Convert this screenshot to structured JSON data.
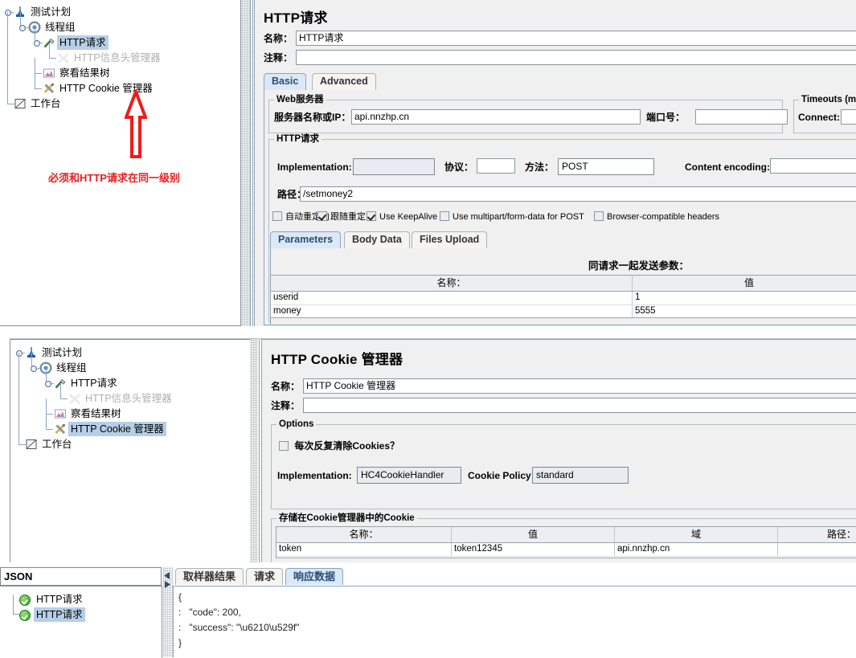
{
  "annotation": {
    "text": "必须和HTTP请求在同一级别",
    "color": "#ee1c1c",
    "arrow": "up-arrow-icon"
  },
  "tree_top": {
    "nodes": [
      {
        "label": "测试计划",
        "icon": "test-plan-icon",
        "state": "normal",
        "indent": 0
      },
      {
        "label": "线程组",
        "icon": "thread-group-icon",
        "state": "normal",
        "indent": 1
      },
      {
        "label": "HTTP请求",
        "icon": "http-request-icon",
        "state": "selected",
        "indent": 2
      },
      {
        "label": "HTTP信息头管理器",
        "icon": "header-manager-icon",
        "state": "disabled",
        "indent": 3
      },
      {
        "label": "察看结果树",
        "icon": "view-results-tree-icon",
        "state": "normal",
        "indent": 2
      },
      {
        "label": "HTTP Cookie 管理器",
        "icon": "cookie-manager-icon",
        "state": "normal",
        "indent": 2
      },
      {
        "label": "工作台",
        "icon": "workbench-icon",
        "state": "normal",
        "indent": 0
      }
    ]
  },
  "tree_bottom": {
    "nodes": [
      {
        "label": "测试计划",
        "icon": "test-plan-icon",
        "state": "normal",
        "indent": 0
      },
      {
        "label": "线程组",
        "icon": "thread-group-icon",
        "state": "normal",
        "indent": 1
      },
      {
        "label": "HTTP请求",
        "icon": "http-request-icon",
        "state": "normal",
        "indent": 2
      },
      {
        "label": "HTTP信息头管理器",
        "icon": "header-manager-icon",
        "state": "disabled",
        "indent": 3
      },
      {
        "label": "察看结果树",
        "icon": "view-results-tree-icon",
        "state": "normal",
        "indent": 2
      },
      {
        "label": "HTTP Cookie 管理器",
        "icon": "cookie-manager-icon",
        "state": "selected",
        "indent": 2
      },
      {
        "label": "工作台",
        "icon": "workbench-icon",
        "state": "normal",
        "indent": 0
      }
    ]
  },
  "http_request": {
    "title": "HTTP请求",
    "name_label": "名称：",
    "name_value": "HTTP请求",
    "comment_label": "注释：",
    "comment_value": "",
    "tabs": [
      {
        "label": "Basic",
        "active": true
      },
      {
        "label": "Advanced",
        "active": false
      }
    ],
    "web_server": {
      "group_title": "Web服务器",
      "server_label": "服务器名称或IP：",
      "server_value": "api.nnzhp.cn",
      "port_label": "端口号：",
      "port_value": ""
    },
    "timeouts": {
      "group_title": "Timeouts (m",
      "connect_label": "Connect:",
      "connect_value": ""
    },
    "request": {
      "group_title": "HTTP请求",
      "implementation_label": "Implementation:",
      "implementation_value": "",
      "protocol_label": "协议：",
      "protocol_value": "",
      "method_label": "方法：",
      "method_value": "POST",
      "content_encoding_label": "Content encoding:",
      "content_encoding_value": "",
      "path_label": "路径：",
      "path_value": "/setmoney2",
      "checkboxes": [
        {
          "label": "自动重定向",
          "checked": false
        },
        {
          "label": "跟随重定向",
          "checked": true
        },
        {
          "label": "Use KeepAlive",
          "checked": true
        },
        {
          "label": "Use multipart/form-data for POST",
          "checked": false
        },
        {
          "label": "Browser-compatible headers",
          "checked": false
        }
      ],
      "param_tabs": [
        {
          "label": "Parameters",
          "active": true
        },
        {
          "label": "Body Data",
          "active": false
        },
        {
          "label": "Files Upload",
          "active": false
        }
      ],
      "params_caption": "同请求一起发送参数：",
      "params_table": {
        "columns": [
          "名称：",
          "值"
        ],
        "rows": [
          [
            "userid",
            "1"
          ],
          [
            "money",
            "5555"
          ]
        ]
      }
    }
  },
  "cookie_manager": {
    "title": "HTTP Cookie 管理器",
    "name_label": "名称：",
    "name_value": "HTTP Cookie 管理器",
    "comment_label": "注释：",
    "comment_value": "",
    "options": {
      "group_title": "Options",
      "clear_cookies_label": "每次反复清除Cookies？",
      "clear_cookies_checked": false,
      "implementation_label": "Implementation:",
      "implementation_value": "HC4CookieHandler",
      "cookie_policy_label": "Cookie Policy:",
      "cookie_policy_value": "standard"
    },
    "stored": {
      "group_title": "存储在Cookie管理器中的Cookie",
      "columns": [
        "名称：",
        "值",
        "域",
        "路径："
      ],
      "rows": [
        [
          "token",
          "token12345",
          "api.nnzhp.cn",
          ""
        ]
      ]
    }
  },
  "results": {
    "renderer_value": "JSON",
    "tree_items": [
      {
        "label": "HTTP请求",
        "status": "green-check-icon",
        "selected": false
      },
      {
        "label": "HTTP请求",
        "status": "green-check-icon",
        "selected": true
      }
    ],
    "tabs": [
      {
        "label": "取样器结果",
        "active": false
      },
      {
        "label": "请求",
        "active": false
      },
      {
        "label": "响应数据",
        "active": true
      }
    ],
    "response_lines": [
      "{",
      ":   \"code\": 200,",
      ":   \"success\": \"\\u6210\\u529f\"",
      "}"
    ]
  }
}
